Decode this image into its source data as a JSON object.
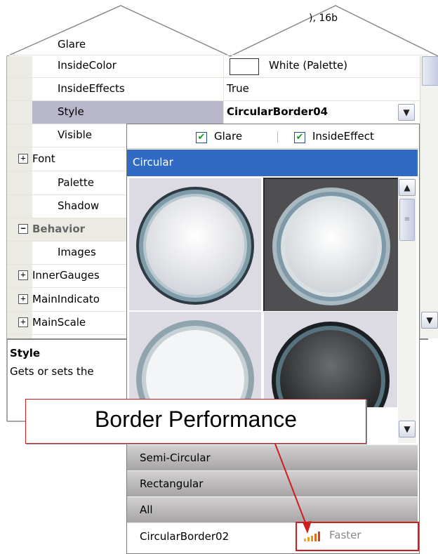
{
  "grid": {
    "top_value_fragment": "), 16b",
    "rows": [
      {
        "name": "Glare",
        "value": ""
      },
      {
        "name": "InsideColor",
        "value": "White (Palette)"
      },
      {
        "name": "InsideEffects",
        "value": "True"
      },
      {
        "name": "Style",
        "value": "CircularBorder04"
      },
      {
        "name": "Visible",
        "value": ""
      },
      {
        "name": "Font",
        "value": ""
      },
      {
        "name": "Palette",
        "value": ""
      },
      {
        "name": "Shadow",
        "value": ""
      },
      {
        "name": "Behavior",
        "value": ""
      },
      {
        "name": "Images",
        "value": ""
      },
      {
        "name": "InnerGauges",
        "value": ""
      },
      {
        "name": "MainIndicato",
        "value": ""
      },
      {
        "name": "MainScale",
        "value": ""
      }
    ],
    "description_title": "Style",
    "description_text": "Gets or sets the"
  },
  "popup": {
    "glare_label": "Glare",
    "inside_effect_label": "InsideEffect",
    "header": "Circular",
    "categories": [
      "Semi-Circular",
      "Rectangular",
      "All"
    ],
    "selected_item": "CircularBorder02",
    "performance_label": "Faster"
  },
  "callout": {
    "text": "Border Performance"
  },
  "colors": {
    "selection": "#316ac5",
    "callout_border": "#cc1f1f",
    "selected_row": "#b8b7c9"
  },
  "icons": [
    "checkbox-checked-icon",
    "chevron-down-icon",
    "scroll-up-icon",
    "scroll-down-icon",
    "plus-box-icon",
    "minus-box-icon",
    "signal-bars-icon"
  ]
}
